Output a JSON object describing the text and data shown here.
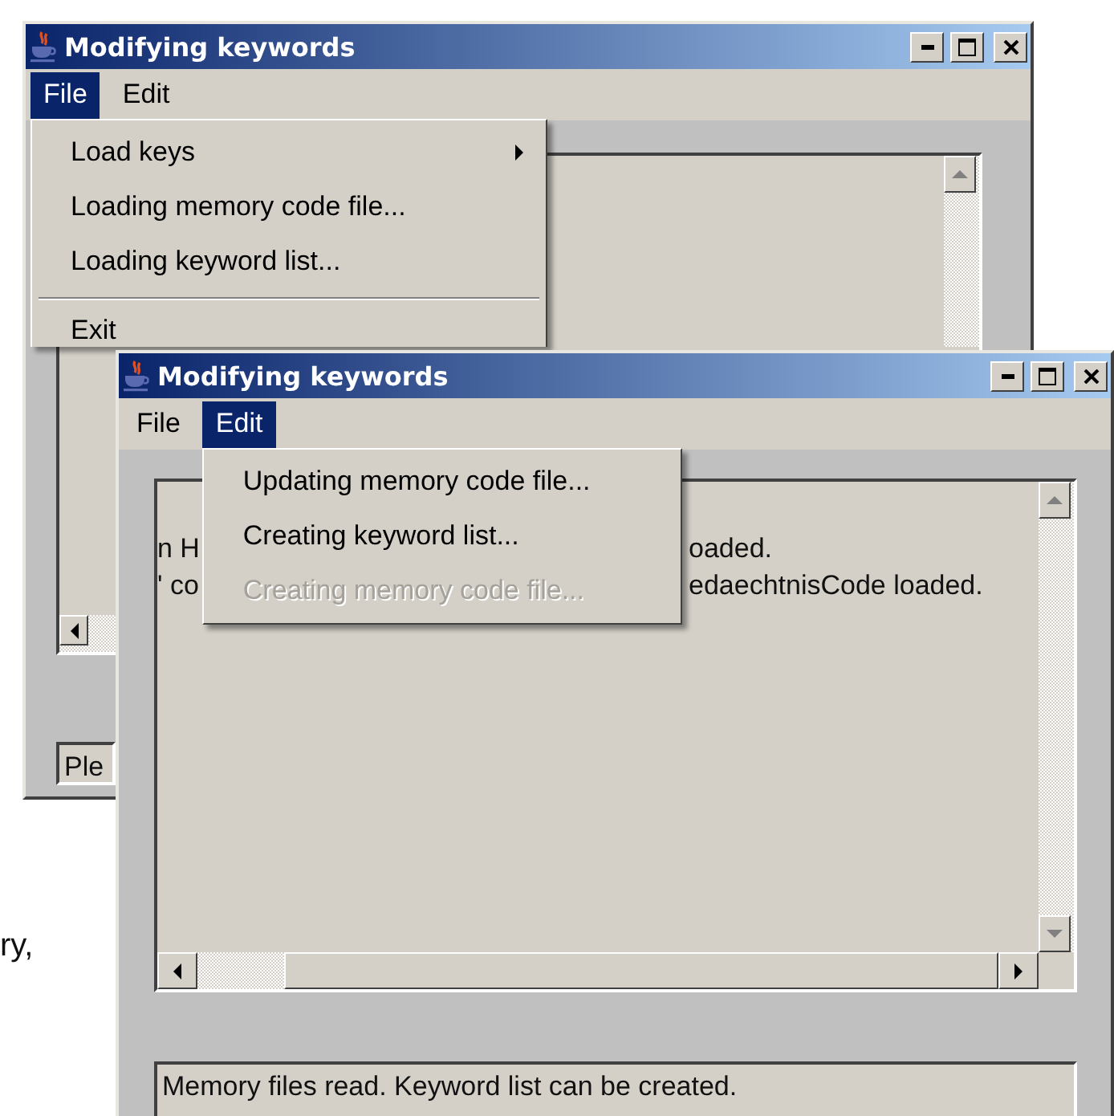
{
  "windows": [
    {
      "title": "Modifying keywords",
      "menus": [
        {
          "label": "File",
          "selected": true,
          "items": [
            {
              "kind": "submenu",
              "label": "Load keys"
            },
            {
              "kind": "item",
              "label": "Loading memory code file..."
            },
            {
              "kind": "item",
              "label": "Loading keyword list..."
            },
            {
              "kind": "separator"
            },
            {
              "kind": "item",
              "label": "Exit"
            }
          ]
        },
        {
          "label": "Edit",
          "selected": false
        }
      ],
      "status": "Ple"
    },
    {
      "title": "Modifying keywords",
      "menus": [
        {
          "label": "File",
          "selected": false
        },
        {
          "label": "Edit",
          "selected": true,
          "items": [
            {
              "kind": "item",
              "label": "Updating memory code file...",
              "disabled": false
            },
            {
              "kind": "item",
              "label": "Creating keyword list...",
              "disabled": false
            },
            {
              "kind": "item",
              "label": "Creating memory code file...",
              "disabled": true
            }
          ]
        }
      ],
      "text_lines": [
        {
          "parts": [
            "n H",
            "oaded."
          ]
        },
        {
          "parts": [
            "' co",
            "edaechtnisCode loaded."
          ]
        }
      ],
      "status": "Memory files read. Keyword list can be created."
    }
  ],
  "background_text": "ry,"
}
